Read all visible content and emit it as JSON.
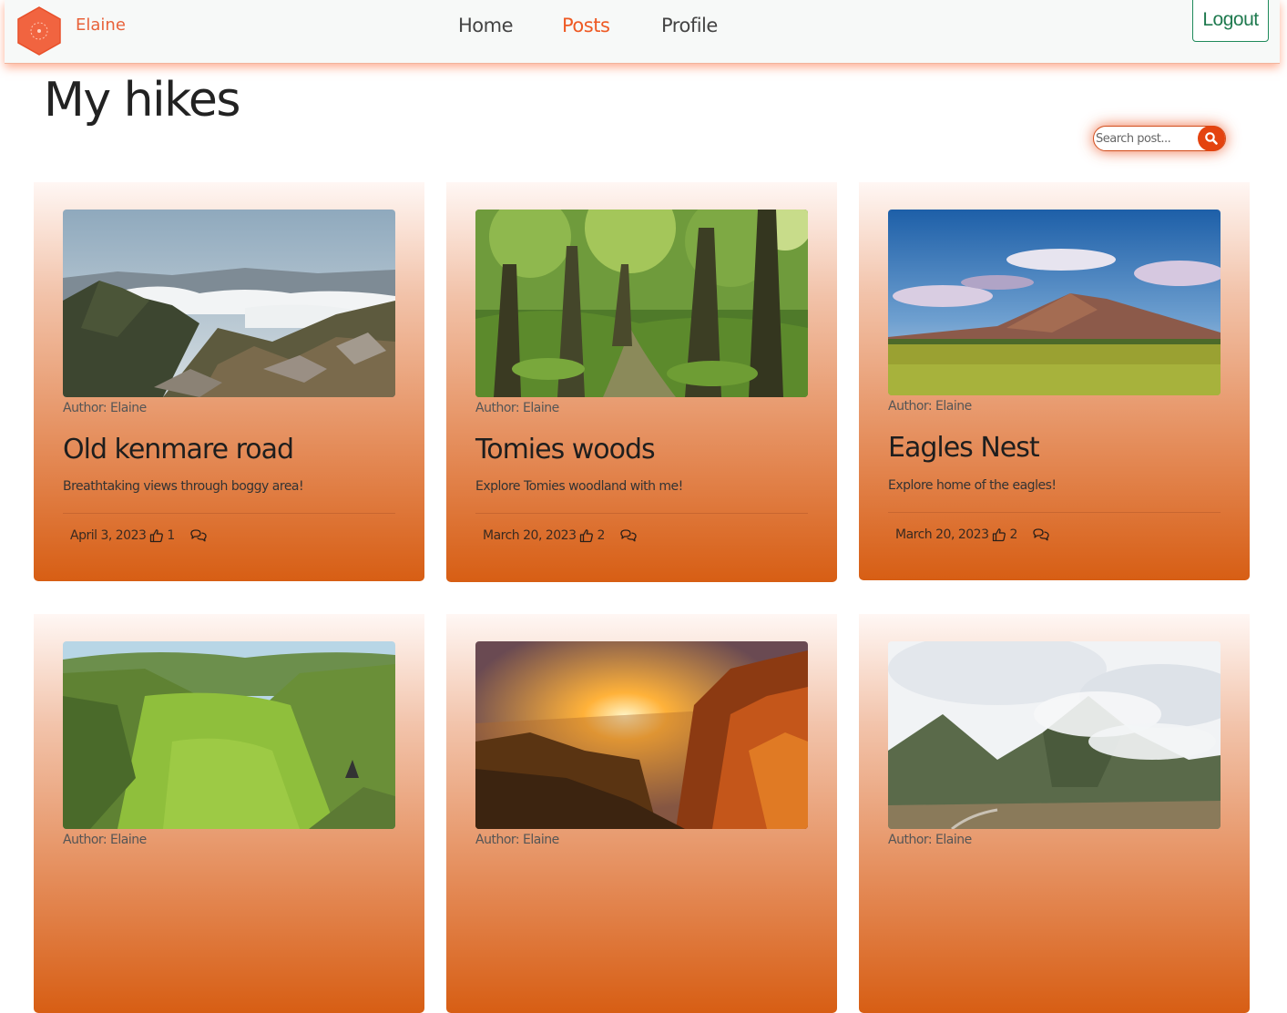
{
  "nav": {
    "username": "Elaine",
    "links": [
      "Home",
      "Posts",
      "Profile"
    ],
    "logout_label": "Logout",
    "accent": "#ee5a24"
  },
  "page": {
    "title": "My hikes"
  },
  "search": {
    "placeholder": "Search post..."
  },
  "posts": [
    {
      "author": "Author: Elaine",
      "title": "Old kenmare road",
      "description": "Breathtaking views through boggy area!",
      "date": "April 3, 2023",
      "likes": "1"
    },
    {
      "author": "Author: Elaine",
      "title": "Tomies woods",
      "description": "Explore Tomies woodland with me!",
      "date": "March 20, 2023",
      "likes": "2"
    },
    {
      "author": "Author: Elaine",
      "title": "Eagles Nest",
      "description": "Explore home of the eagles!",
      "date": "March 20, 2023",
      "likes": "2"
    },
    {
      "author": "Author: Elaine"
    },
    {
      "author": "Author: Elaine"
    },
    {
      "author": "Author: Elaine"
    }
  ]
}
